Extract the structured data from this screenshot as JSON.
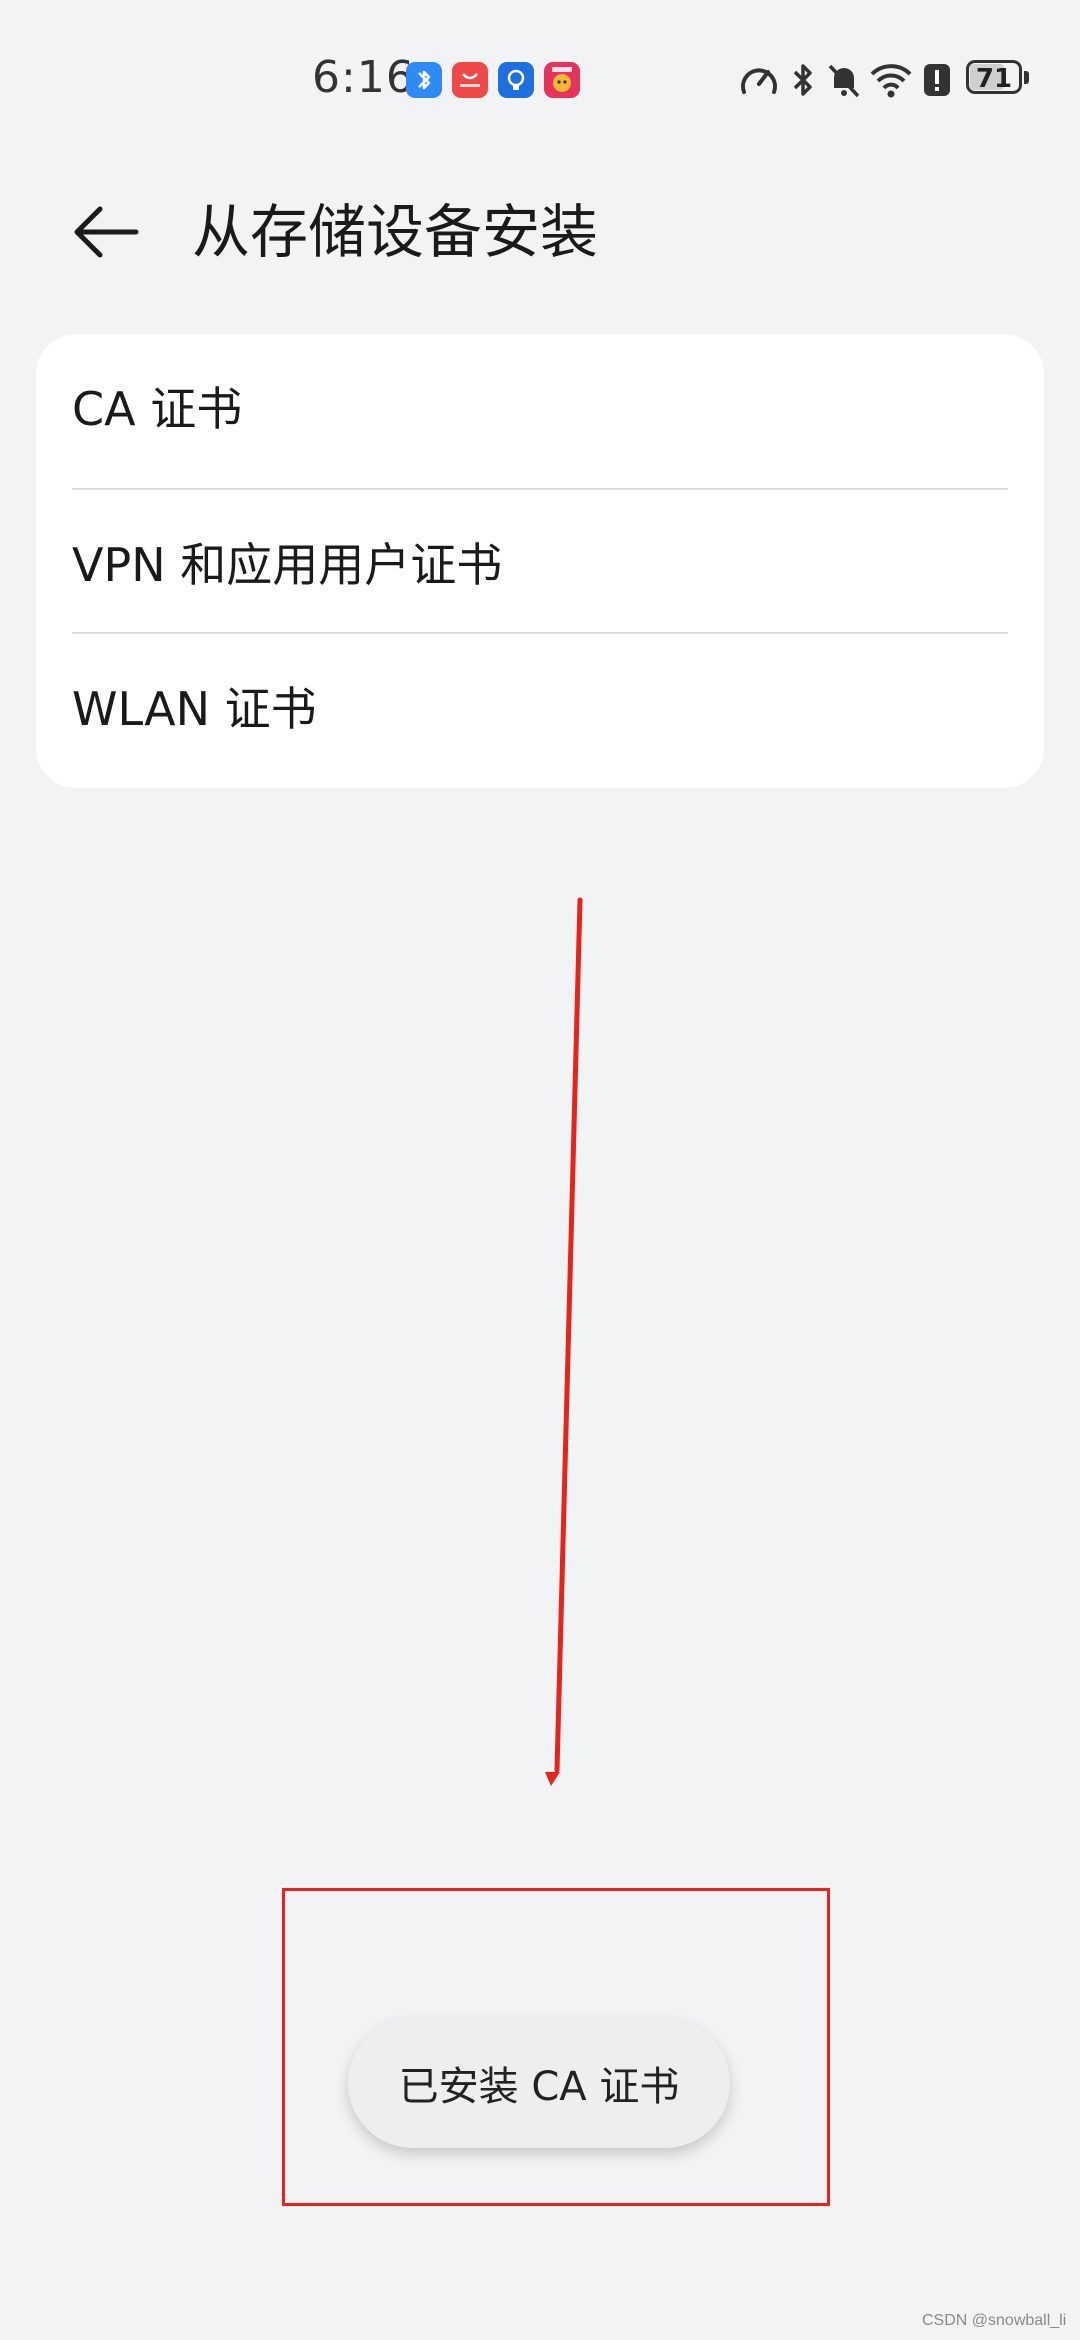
{
  "status_bar": {
    "time": "6:16",
    "notification_icons": [
      "bluetooth-icon",
      "huawei-appgallery-icon",
      "lightbulb-tips-icon",
      "shopping-app-icon"
    ],
    "system_icons": [
      "data-speed-icon",
      "bluetooth-icon",
      "mute-bell-icon",
      "wifi-icon",
      "alert-icon",
      "battery-icon"
    ],
    "battery_percent": "71"
  },
  "header": {
    "title": "从存储设备安装"
  },
  "menu": {
    "items": [
      {
        "label": "CA 证书"
      },
      {
        "label": "VPN 和应用用户证书"
      },
      {
        "label": "WLAN 证书"
      }
    ]
  },
  "toast": {
    "message": "已安装 CA 证书"
  },
  "annotation": {
    "color": "#e8231b"
  },
  "watermark": {
    "text": "CSDN @snowball_li"
  }
}
